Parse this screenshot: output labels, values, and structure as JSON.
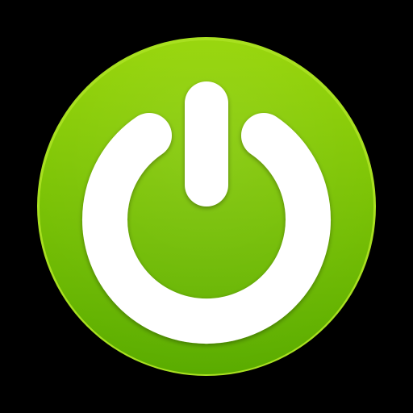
{
  "icon": {
    "name": "power-icon",
    "background_color": "#000000",
    "button_color_top": "#93d400",
    "button_color_bottom": "#5aac00",
    "rim_color": "#a8e020",
    "symbol_color": "#ffffff",
    "shadow_color": "#3c7a00"
  }
}
